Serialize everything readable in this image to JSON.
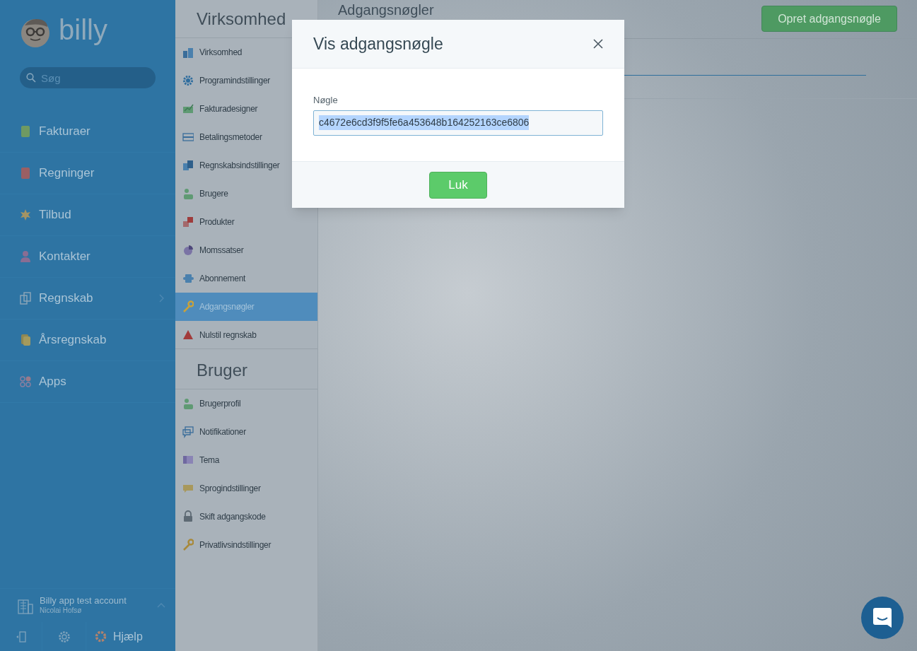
{
  "sidebar": {
    "logo": "billy",
    "search": {
      "placeholder": "Søg"
    },
    "items": [
      {
        "label": "Fakturaer",
        "has_submenu": false
      },
      {
        "label": "Regninger",
        "has_submenu": false
      },
      {
        "label": "Tilbud",
        "has_submenu": false
      },
      {
        "label": "Kontakter",
        "has_submenu": false
      },
      {
        "label": "Regnskab",
        "has_submenu": true
      },
      {
        "label": "Årsregnskab",
        "has_submenu": false
      },
      {
        "label": "Apps",
        "has_submenu": false
      }
    ],
    "account": {
      "name": "Billy app test account",
      "user": "Nicolai Hofsø"
    },
    "help_label": "Hjælp"
  },
  "settings_nav": [
    {
      "title": "Virksomhed",
      "items": [
        {
          "label": "Virksomhed",
          "selected": false
        },
        {
          "label": "Programindstillinger",
          "selected": false
        },
        {
          "label": "Fakturadesigner",
          "selected": false
        },
        {
          "label": "Betalingsmetoder",
          "selected": false
        },
        {
          "label": "Regnskabsindstillinger",
          "selected": false
        },
        {
          "label": "Brugere",
          "selected": false
        },
        {
          "label": "Produkter",
          "selected": false
        },
        {
          "label": "Momssatser",
          "selected": false
        },
        {
          "label": "Abonnement",
          "selected": false
        },
        {
          "label": "Adgangsnøgler",
          "selected": true
        },
        {
          "label": "Nulstil regnskab",
          "selected": false
        }
      ]
    },
    {
      "title": "Bruger",
      "items": [
        {
          "label": "Brugerprofil",
          "selected": false
        },
        {
          "label": "Notifikationer",
          "selected": false
        },
        {
          "label": "Tema",
          "selected": false
        },
        {
          "label": "Sprogindstillinger",
          "selected": false
        },
        {
          "label": "Skift adgangskode",
          "selected": false
        },
        {
          "label": "Privatlivsindstillinger",
          "selected": false
        }
      ]
    }
  ],
  "main": {
    "title": "Adgangsnøgler",
    "create_button": "Opret adgangsnøgle"
  },
  "modal": {
    "title": "Vis adgangsnøgle",
    "field_label": "Nøgle",
    "value": "c4672e6cd3f9f5fe6a453648b164252163ce6806",
    "value_selected": true,
    "button": "Luk"
  }
}
